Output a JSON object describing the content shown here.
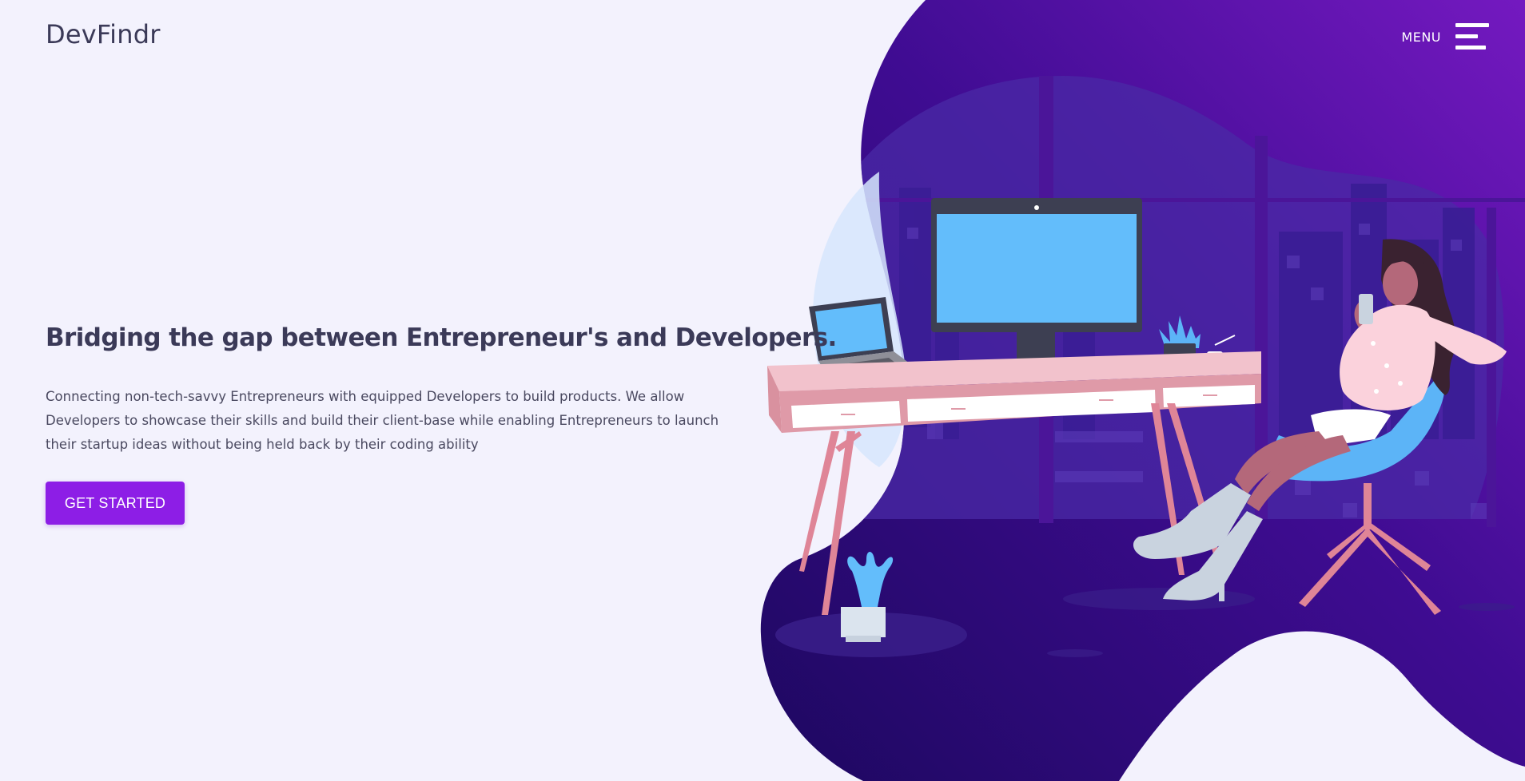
{
  "header": {
    "brand": "DevFindr",
    "menu_label": "MENU"
  },
  "hero": {
    "headline": "Bridging the gap between Entrepreneur's and Developers.",
    "description": "Connecting non-tech-savvy Entrepreneurs with equipped Developers to build products. We allow Developers to showcase their skills and build their client-base while enabling Entrepreneurs to launch their startup ideas without being held back by their coding ability",
    "cta_label": "GET STARTED"
  },
  "icons": {
    "menu": "hamburger-menu-icon"
  },
  "colors": {
    "page_background": "#f3f2fd",
    "text_dark": "#3b3a58",
    "accent": "#8d1ee6",
    "blob_dark": "#230a6e",
    "blob_light": "#7116bf",
    "screen_blue": "#63bdfb",
    "desk_pink": "#f2c2cc"
  }
}
